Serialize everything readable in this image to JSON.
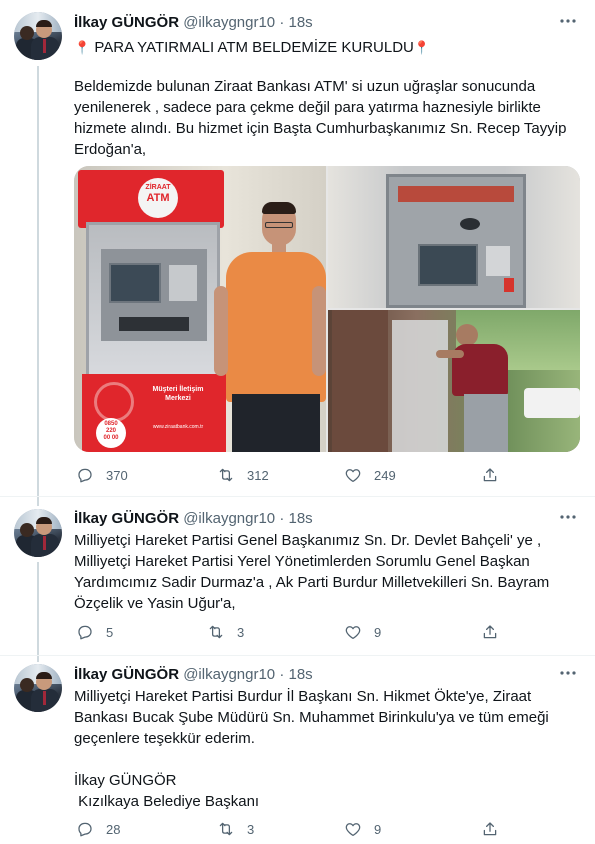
{
  "tweets": [
    {
      "name": "İlkay GÜNGÖR",
      "handle": "@ilkaygngr10",
      "dot": "·",
      "time": "18s",
      "title_pin_left": "📍",
      "title": "PARA YATIRMALI ATM BELDEMİZE KURULDU",
      "title_pin_right": "📍",
      "body": "Beldemizde bulunan Ziraat Bankası ATM' si uzun uğraşlar sonucunda yenilenerek , sadece para çekme değil para yatırma haznesiyle birlikte hizmete alındı. Bu hizmet için Başta Cumhurbaşkanımız Sn. Recep Tayyip Erdoğan'a,",
      "replies": "370",
      "retweets": "312",
      "likes": "249",
      "media": {
        "atm_sign": "ATM",
        "atm_brand": "ZİRAAT",
        "panel_line1": "Müşteri İletişim",
        "panel_line2": "Merkezi",
        "panel_phone1": "0850",
        "panel_phone2": "220",
        "panel_phone3": "00 00",
        "panel_url": "www.ziraatbank.com.tr"
      }
    },
    {
      "name": "İlkay GÜNGÖR",
      "handle": "@ilkaygngr10",
      "dot": "·",
      "time": "18s",
      "body": "Milliyetçi Hareket Partisi Genel Başkanımız Sn. Dr. Devlet Bahçeli' ye ,\nMilliyetçi Hareket Partisi Yerel Yönetimlerden Sorumlu Genel Başkan\nYardımcımız Sadir Durmaz'a , Ak Parti Burdur Milletvekilleri Sn. Bayram\nÖzçelik ve Yasin Uğur'a,",
      "replies": "5",
      "retweets": "3",
      "likes": "9"
    },
    {
      "name": "İlkay GÜNGÖR",
      "handle": "@ilkaygngr10",
      "dot": "·",
      "time": "18s",
      "body": "Milliyetçi Hareket Partisi Burdur İl Başkanı Sn. Hikmet Ökte'ye, Ziraat\nBankası Bucak Şube Müdürü Sn. Muhammet Birinkulu'ya ve tüm emeği\ngeçenlere teşekkür ederim.\n\nİlkay GÜNGÖR\n Kızılkaya Belediye Başkanı",
      "replies": "28",
      "retweets": "3",
      "likes": "9"
    }
  ],
  "icons": {
    "reply": "reply-icon",
    "retweet": "retweet-icon",
    "like": "heart-icon",
    "share": "share-icon",
    "more": "more-icon",
    "pin": "round-pushpin-emoji"
  },
  "colors": {
    "text": "#0f1419",
    "secondary": "#536471",
    "thread_line": "#cfd9de",
    "ziraat_red": "#e0262c"
  }
}
